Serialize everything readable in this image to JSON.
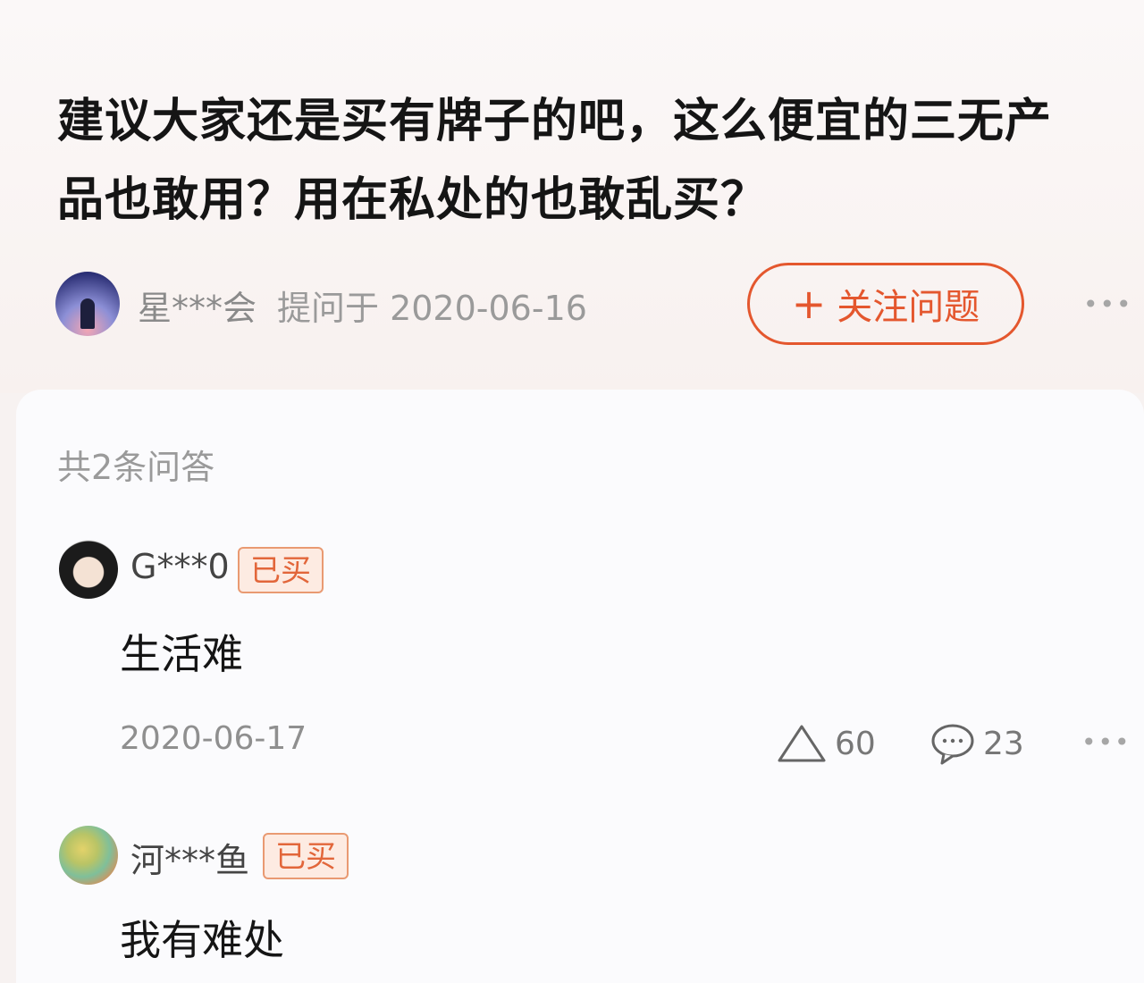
{
  "question": {
    "title": "建议大家还是买有牌子的吧，这么便宜的三无产品也敢用？用在私处的也敢乱买？",
    "asker_name": "星***会",
    "asked_meta": "提问于 2020-06-16",
    "follow_label": "关注问题",
    "follow_icon": "plus-icon",
    "more_icon": "ellipsis-icon"
  },
  "answers_section": {
    "count_label": "共2条问答",
    "answers": [
      {
        "user": "G***0",
        "badge": "已买",
        "text": "生活难",
        "date": "2020-06-17",
        "likes": "60",
        "comments": "23"
      },
      {
        "user": "河***鱼",
        "badge": "已买",
        "text": "我有难处"
      }
    ]
  },
  "colors": {
    "accent": "#e4572e",
    "badge_bg": "#fdebe2",
    "badge_border": "#e99a72"
  }
}
